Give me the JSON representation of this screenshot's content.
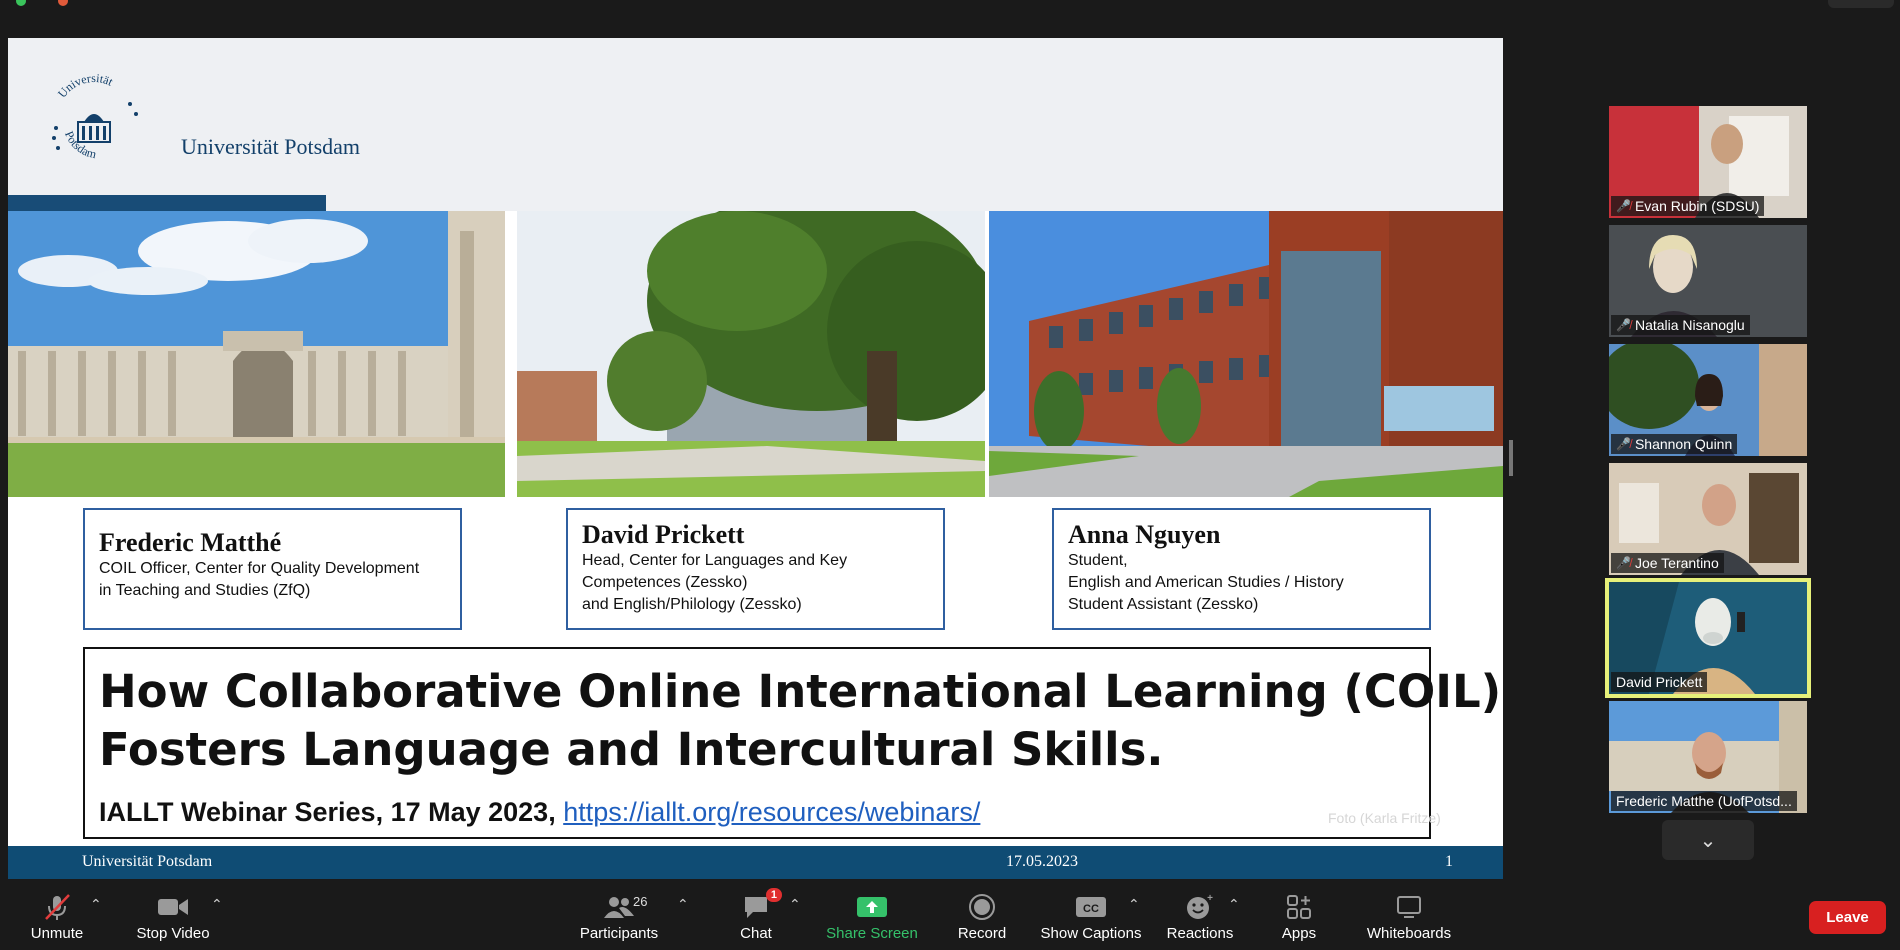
{
  "slide": {
    "logo_ring_top": "Universität",
    "logo_ring_bottom": "Potsdam",
    "logo_name": "Universität Potsdam",
    "presenters": [
      {
        "name": "Frederic Matthé",
        "lines": [
          "COIL Officer, Center for Quality Development",
          "in Teaching and Studies (ZfQ)"
        ]
      },
      {
        "name": "David Prickett",
        "lines": [
          "Head, Center for Languages and Key",
          "Competences (Zessko)",
          "and English/Philology (Zessko)"
        ]
      },
      {
        "name": "Anna Nguyen",
        "lines": [
          "Student,",
          "English and American Studies / History",
          "Student Assistant  (Zessko)"
        ]
      }
    ],
    "title_line1": "How Collaborative Online International Learning (COIL)",
    "title_line2": "Fosters Language and Intercultural Skills.",
    "subtitle_prefix": "IALLT Webinar Series, 17 May 2023, ",
    "subtitle_link": "https://iallt.org/resources/webinars/",
    "photo_credit": "Foto (Karla Fritze)",
    "footer_left": "Universität Potsdam",
    "footer_date": "17.05.2023",
    "footer_page": "1"
  },
  "participants": [
    {
      "name": "Evan Rubin (SDSU)",
      "muted": true,
      "active": false
    },
    {
      "name": "Natalia Nisanoglu",
      "muted": true,
      "active": false
    },
    {
      "name": "Shannon Quinn",
      "muted": true,
      "active": false
    },
    {
      "name": "Joe Terantino",
      "muted": true,
      "active": false
    },
    {
      "name": "David Prickett",
      "muted": false,
      "active": true
    },
    {
      "name": "Frederic Matthe (UofPotsd...",
      "muted": false,
      "active": false
    }
  ],
  "toolbar": {
    "unmute": "Unmute",
    "stop_video": "Stop Video",
    "participants": "Participants",
    "participants_count": "26",
    "chat": "Chat",
    "chat_badge": "1",
    "share_screen": "Share Screen",
    "record": "Record",
    "show_captions": "Show Captions",
    "cc_glyph": "CC",
    "reactions": "Reactions",
    "apps": "Apps",
    "whiteboards": "Whiteboards",
    "leave": "Leave"
  },
  "colors": {
    "uni_blue": "#0f4c74",
    "active_speaker": "#e6f07a",
    "leave_red": "#d82020",
    "share_green": "#35c16a"
  }
}
